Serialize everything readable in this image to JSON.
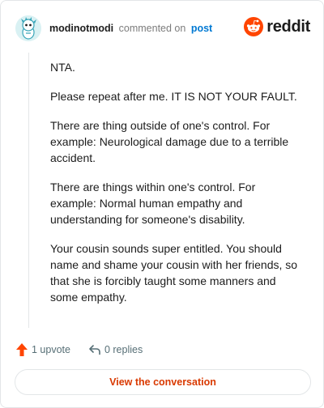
{
  "comment": {
    "username": "modinotmodi",
    "verb": "commented on",
    "post_link": "post",
    "paragraphs": [
      "NTA.",
      "Please repeat after me. IT IS NOT YOUR FAULT.",
      "There are thing outside of one's control. For example: Neurological damage due to a terrible accident.",
      "There are things within one's control. For example: Normal human empathy and understanding for someone's disability.",
      "Your cousin sounds super entitled. You should name and shame your cousin with her friends, so that she is forcibly taught some manners and some empathy."
    ]
  },
  "brand": {
    "wordmark": "reddit",
    "color": "#ff4500"
  },
  "actions": {
    "upvotes": "1 upvote",
    "replies": "0 replies"
  },
  "cta": {
    "label": "View the conversation",
    "color": "#d93900"
  },
  "icons": {
    "avatar": "snoo-avatar-icon",
    "logo": "reddit-snoo-icon",
    "upvote": "upvote-arrow-icon",
    "reply": "reply-arrow-icon"
  }
}
